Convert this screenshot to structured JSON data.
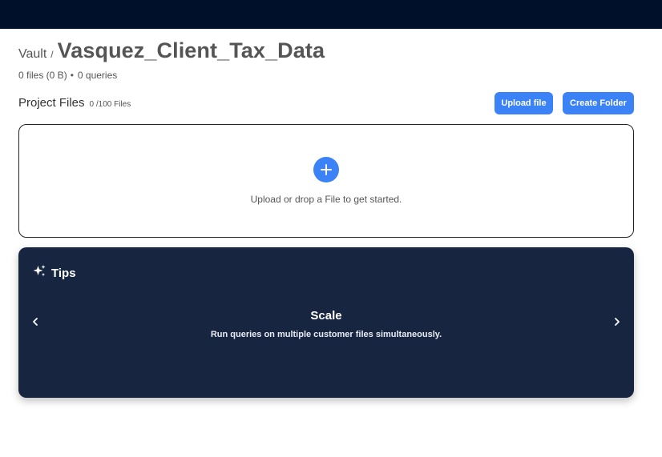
{
  "breadcrumb": {
    "root": "Vault",
    "separator": "/",
    "title": "Vasquez_Client_Tax_Data"
  },
  "meta": {
    "files": "0 files (0 B)",
    "dot": "•",
    "queries": "0 queries"
  },
  "project_files": {
    "label": "Project Files",
    "count": "0 /100 Files"
  },
  "buttons": {
    "upload": "Upload file",
    "create_folder": "Create Folder"
  },
  "dropzone": {
    "text": "Upload or drop a File to get started.",
    "icon": "plus-icon"
  },
  "tips": {
    "header": "Tips",
    "header_icon": "sparkles-icon",
    "title": "Scale",
    "body": "Run queries on multiple customer files simultaneously.",
    "prev_icon": "chevron-left-icon",
    "next_icon": "chevron-right-icon"
  },
  "colors": {
    "topbar": "#000f2a",
    "accent": "#3b82f6",
    "tips_bg": "#182540"
  }
}
